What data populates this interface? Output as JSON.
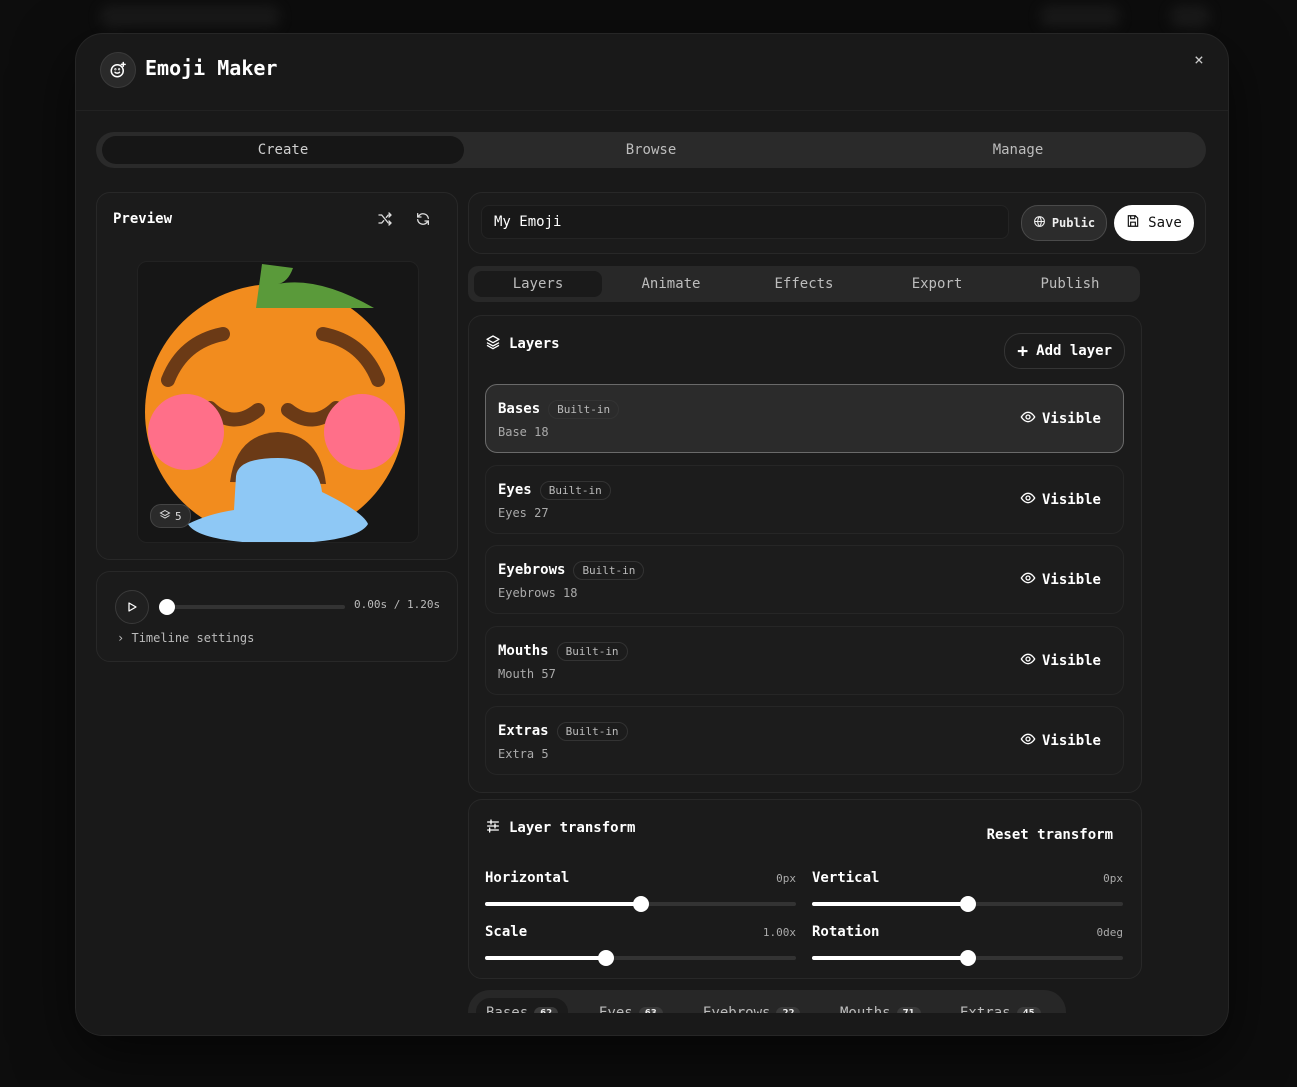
{
  "app": {
    "title": "Emoji Maker",
    "close_label": "×"
  },
  "main_tabs": [
    {
      "label": "Create",
      "active": true
    },
    {
      "label": "Browse",
      "active": false
    },
    {
      "label": "Manage",
      "active": false
    }
  ],
  "preview": {
    "title": "Preview",
    "layer_count": "5",
    "emoji": {
      "face_color": "#f28c1e",
      "leaf_color": "#5a9a3a",
      "cheek_color": "#ff6f89",
      "drool_color": "#8ec8f5",
      "feature_color": "#6b3a16"
    }
  },
  "timeline": {
    "time": "0.00s / 1.20s",
    "progress": 0,
    "settings_label": "Timeline settings"
  },
  "emoji_name": {
    "value": "My Emoji"
  },
  "visibility_label": "Public",
  "save_label": "Save",
  "sub_tabs": [
    {
      "label": "Layers",
      "active": true
    },
    {
      "label": "Animate",
      "active": false
    },
    {
      "label": "Effects",
      "active": false
    },
    {
      "label": "Export",
      "active": false
    },
    {
      "label": "Publish",
      "active": false
    }
  ],
  "layers": {
    "title": "Layers",
    "add_label": "Add layer",
    "items": [
      {
        "name": "Bases",
        "tag": "Built-in",
        "value": "Base 18",
        "visible": "Visible",
        "selected": true
      },
      {
        "name": "Eyes",
        "tag": "Built-in",
        "value": "Eyes 27",
        "visible": "Visible",
        "selected": false
      },
      {
        "name": "Eyebrows",
        "tag": "Built-in",
        "value": "Eyebrows 18",
        "visible": "Visible",
        "selected": false
      },
      {
        "name": "Mouths",
        "tag": "Built-in",
        "value": "Mouth 57",
        "visible": "Visible",
        "selected": false
      },
      {
        "name": "Extras",
        "tag": "Built-in",
        "value": "Extra 5",
        "visible": "Visible",
        "selected": false
      }
    ]
  },
  "transform": {
    "title": "Layer transform",
    "reset_label": "Reset transform",
    "sliders": [
      {
        "label": "Horizontal",
        "value": "0px",
        "fraction": 0.5
      },
      {
        "label": "Vertical",
        "value": "0px",
        "fraction": 0.5
      },
      {
        "label": "Scale",
        "value": "1.00x",
        "fraction": 0.39
      },
      {
        "label": "Rotation",
        "value": "0deg",
        "fraction": 0.5
      }
    ]
  },
  "category_tabs": [
    {
      "label": "Bases",
      "count": "62",
      "active": true
    },
    {
      "label": "Eyes",
      "count": "63",
      "active": false
    },
    {
      "label": "Eyebrows",
      "count": "22",
      "active": false
    },
    {
      "label": "Mouths",
      "count": "71",
      "active": false
    },
    {
      "label": "Extras",
      "count": "45",
      "active": false
    }
  ]
}
